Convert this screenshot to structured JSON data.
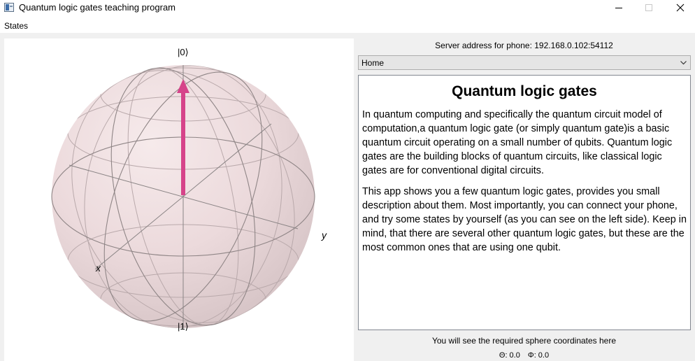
{
  "window": {
    "title": "Quantum logic gates teaching program"
  },
  "menu": {
    "items": [
      "States"
    ]
  },
  "sphere": {
    "label_top": "|0⟩",
    "label_bottom": "|1⟩",
    "label_x": "x",
    "label_y": "y",
    "vector_color": "#d6448a",
    "sphere_color": "#e9d3d5",
    "theta": 0,
    "phi": 0
  },
  "right_panel": {
    "server_label": "Server address for phone: 192.168.0.102:54112",
    "combo_value": "Home",
    "doc_title": "Quantum logic gates",
    "paragraphs": [
      "In quantum computing and specifically the quantum circuit model of computation,a quantum logic gate (or simply quantum gate)is a basic quantum circuit operating on a small number of qubits. Quantum logic gates are the building blocks of quantum circuits, like classical logic gates are for conventional digital circuits.",
      "This app shows you a few quantum logic gates, provides you small description about them. Most importantly, you can connect your phone, and try some states by yourself (as you can see on the left side). Keep in mind, that there are several other quantum logic gates, but these are the most common ones that are using one qubit."
    ],
    "coords_hint": "You will see the required sphere coordinates here",
    "theta_label": "Θ: 0.0",
    "phi_label": "Φ: 0.0"
  }
}
